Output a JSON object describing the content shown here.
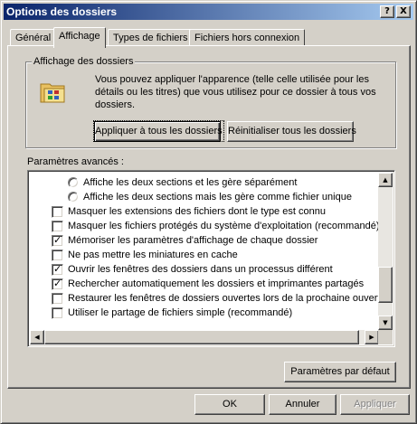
{
  "window": {
    "title": "Options des dossiers",
    "help_glyph": "?",
    "close_glyph": "X"
  },
  "tabs": [
    {
      "label": "Général",
      "active": false
    },
    {
      "label": "Affichage",
      "active": true
    },
    {
      "label": "Types de fichiers",
      "active": false
    },
    {
      "label": "Fichiers hors connexion",
      "active": false
    }
  ],
  "folder_view": {
    "legend": "Affichage des dossiers",
    "description": "Vous pouvez appliquer l'apparence (telle celle utilisée pour les détails ou les titres) que vous utilisez pour ce dossier à tous vos dossiers.",
    "apply_all_label": "Appliquer à tous les dossiers",
    "reset_all_label": "Réinitialiser tous les dossiers"
  },
  "advanced": {
    "label": "Paramètres avancés :",
    "items": [
      {
        "type": "radio",
        "checked": false,
        "label": "Affiche les deux sections et les gère séparément"
      },
      {
        "type": "radio",
        "checked": false,
        "label": "Affiche les deux sections mais les gère comme fichier unique"
      },
      {
        "type": "checkbox",
        "checked": false,
        "label": "Masquer les extensions des fichiers dont le type est connu"
      },
      {
        "type": "checkbox",
        "checked": false,
        "label": "Masquer les fichiers protégés du système d'exploitation (recommandé)"
      },
      {
        "type": "checkbox",
        "checked": true,
        "label": "Mémoriser les paramètres d'affichage de chaque dossier"
      },
      {
        "type": "checkbox",
        "checked": false,
        "label": "Ne pas mettre les miniatures en cache"
      },
      {
        "type": "checkbox",
        "checked": true,
        "label": "Ouvrir les fenêtres des dossiers dans un processus différent"
      },
      {
        "type": "checkbox",
        "checked": true,
        "label": "Rechercher automatiquement les dossiers et imprimantes partagés"
      },
      {
        "type": "checkbox",
        "checked": false,
        "label": "Restaurer les fenêtres de dossiers ouvertes lors de la prochaine ouverture"
      },
      {
        "type": "checkbox",
        "checked": false,
        "label": "Utiliser le partage de fichiers simple (recommandé)"
      }
    ],
    "defaults_label": "Paramètres par défaut"
  },
  "footer": {
    "ok_label": "OK",
    "cancel_label": "Annuler",
    "apply_label": "Appliquer"
  }
}
